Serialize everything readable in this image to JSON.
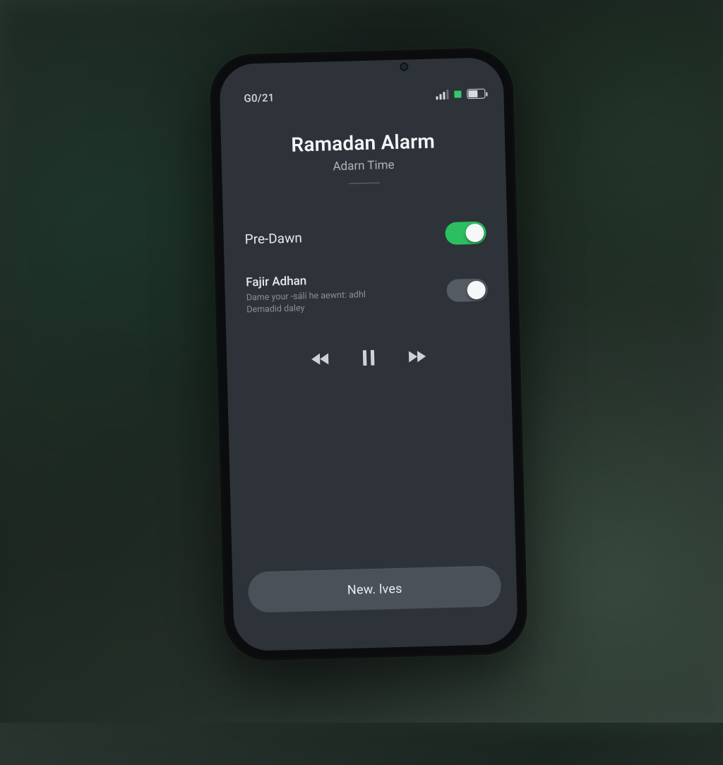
{
  "status_bar": {
    "time_label": "G0/21"
  },
  "header": {
    "title": "Ramadan Alarm",
    "subtitle": "Adarn Time"
  },
  "alarms": {
    "predawn": {
      "label": "Pre-Dawn",
      "enabled": true
    },
    "fajr": {
      "label": "Fajir Adhan",
      "description_line1": "Dame your -sálí he aewnt: adhl",
      "description_line2": "Demadid daley",
      "enabled": false
    }
  },
  "media": {
    "prev_icon": "skip-back",
    "play_icon": "pause",
    "next_icon": "skip-forward"
  },
  "footer": {
    "button_label": "New. lves"
  },
  "colors": {
    "accent_green": "#2bbf5f",
    "screen_bg": "#2e333a",
    "button_bg": "#4a5159"
  }
}
